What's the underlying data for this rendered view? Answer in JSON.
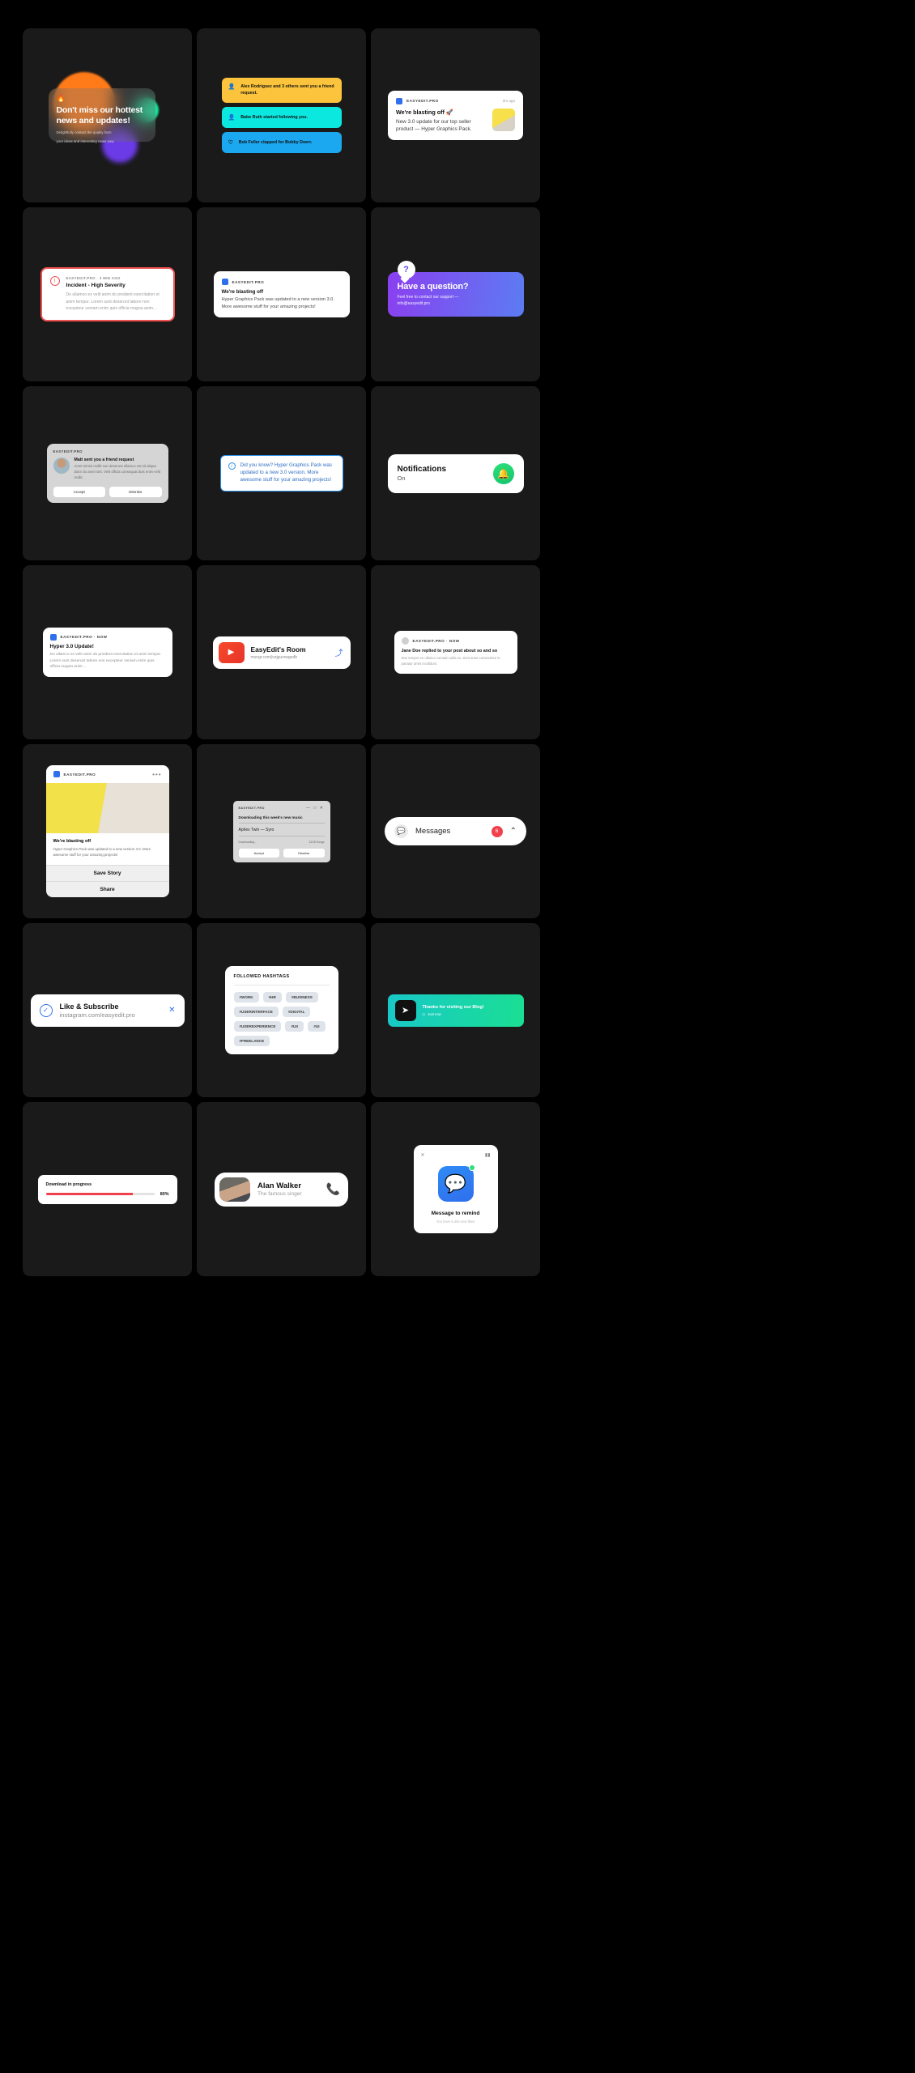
{
  "page": {
    "background": "#000000",
    "card_background": "#1a1a1a"
  },
  "cards": {
    "hot_news": {
      "icon": "flame-icon",
      "icon_glyph": "🔥",
      "title": "Don't miss our hottest news and updates!",
      "subtitle_line1": "Delightfully contact the quality form",
      "subtitle_line2": "your ideas and interesting news now"
    },
    "pills": [
      {
        "icon": "person-add-icon",
        "icon_glyph": "👤",
        "text": "Alex Rodriguez and 3 others sent you a friend request.",
        "color": "#FBC43C"
      },
      {
        "icon": "person-icon",
        "icon_glyph": "👤",
        "text": "Babe Ruth started following you.",
        "color": "#0BE8E0"
      },
      {
        "icon": "heart-icon",
        "icon_glyph": "♡",
        "text": "Bob Feller clapped for Bobby Doerr.",
        "color": "#1BA8F0"
      }
    ],
    "blasting_off": {
      "brand": "EASYEDIT.PRO",
      "time": "3m ago",
      "title": "We're blasting off 🚀",
      "body": "New 3.0 update for our top seller product — Hyper Graphics Pack.",
      "thumbnail": "statue-thumbnail"
    },
    "incident": {
      "meta": "EASYEDIT.PRO  ·  3 MIN AGO",
      "icon": "alert-circle-icon",
      "title": "Incident - High Severity",
      "body": "Do ullamco ex velit anim do proident exercitation et anim tempor. Lorem sunt deserunt labore non excepteur veniam enim quis officia magna anim…",
      "accent": "#F05252"
    },
    "blasting_plain": {
      "brand": "EASYEDIT.PRO",
      "title": "We're blasting off",
      "body": "Hyper Graphics Pack was updated to a new version 3.0. More awesome stuff for your amazing projects!"
    },
    "question": {
      "bubble_glyph": "?",
      "title": "Have a question?",
      "body_line1": "Feel free to contact our support —",
      "body_line2": "info@easyedit.pro",
      "gradient_from": "#8A3FF0",
      "gradient_to": "#5C7CF2"
    },
    "friend_request": {
      "brand": "EASYEDIT.PRO",
      "title": "Matt sent you a friend request",
      "body": "Amet minim mollit non deserunt ullamco est sit aliqua dolor do amet sint. Velit officia consequat duis enim velit mollit.",
      "accept_label": "Accept",
      "dismiss_label": "Dismiss"
    },
    "did_you_know": {
      "icon": "info-icon",
      "icon_glyph": "i",
      "body": "Did you know? Hyper Graphics Pack was updated to a new 3.0 version. More awesome stuff for your amazing projects!",
      "accent": "#2F90E8"
    },
    "notifications": {
      "title": "Notifications",
      "status": "On",
      "bell_glyph": "🔔",
      "accent": "#14C46A"
    },
    "hyper_update": {
      "brand": "EASYEDIT.PRO  ·  NOW",
      "title": "Hyper 3.0 Update!",
      "body": "Do ullamco ex velit anim do proident exercitation et anim tempor. Lorem sunt deserunt labore non excepteur veniam enim quis officia magna anim…"
    },
    "room": {
      "icon": "video-camera-icon",
      "icon_glyph": "▶",
      "title": "EasyEdit's Room",
      "subtitle": "msngr.com/jvzjguvrwgedb",
      "share_glyph": "⤴"
    },
    "jane_doe": {
      "brand": "EASYEDIT.PRO  ·  NOW",
      "title": "Jane Doe replied to your post about so and so",
      "body": "Non tempor eu ullamco veniam nulla ex. Sunt amet consectetur in pariatur amet incididunt."
    },
    "story": {
      "brand": "EASYEDIT.PRO",
      "menu_glyph": "•••",
      "title": "We're blasting off",
      "body": "Hyper Graphics Pack was updated to a new version 3.0. More awesome stuff for your amazing projects!",
      "save_label": "Save Story",
      "share_label": "Share"
    },
    "music": {
      "brand": "EASYEDIT.PRO",
      "window_controls": "— □ ✕",
      "title": "Downloading this week's new music",
      "track": "Aphex Twin — Syro",
      "status_left": "Downloading…",
      "status_right": "12/18 Songs",
      "accept_label": "Accept",
      "dismiss_label": "Dismiss"
    },
    "messages": {
      "icon": "chat-bubble-icon",
      "icon_glyph": "💬",
      "title": "Messages",
      "count": "6",
      "chevron_glyph": "⌃",
      "badge_color": "#F0404B"
    },
    "subscribe": {
      "icon": "check-circle-icon",
      "icon_glyph": "✓",
      "title": "Like & Subscribe",
      "subtitle": "instagram.com/easyedit.pro",
      "close_glyph": "✕",
      "accent": "#2F6FED"
    },
    "hashtags": {
      "header": "FOLLOWED HASHTAGS",
      "tags": [
        "#WORK",
        "#HR",
        "#BUSINESS",
        "#USERINTERFACE",
        "#DIGITAL",
        "#USEREXPERIENCE",
        "#UX",
        "#UI",
        "#FREELANCE"
      ]
    },
    "thanks": {
      "icon": "paper-plane-icon",
      "icon_glyph": "➤",
      "title": "Thanks for visiting our Blog!",
      "subtitle": "Just now",
      "clock_glyph": "◷",
      "gradient_from": "#18C8C8",
      "gradient_to": "#1ADF93"
    },
    "download": {
      "title": "Download in progress",
      "percent": "80%",
      "progress_value": 80,
      "bar_color": "#F0404B"
    },
    "alan_walker": {
      "title": "Alan Walker",
      "subtitle": "The famous singer",
      "phone_glyph": "📞",
      "accent": "#14C46A"
    },
    "message_remind": {
      "close_glyph": "✕",
      "signal_glyph": "▮▮",
      "icon": "messages-app-icon",
      "icon_glyph": "💬",
      "title": "Message to remind",
      "subtitle": "You have 5,452 new likes"
    }
  }
}
